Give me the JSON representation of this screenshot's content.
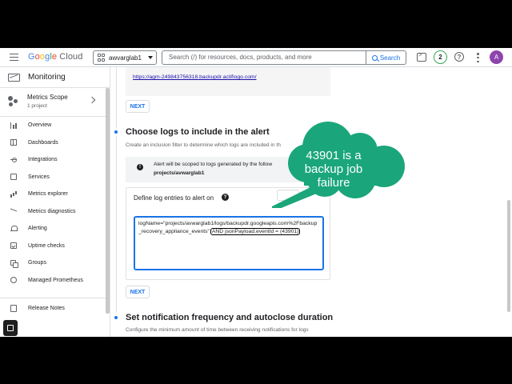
{
  "topbar": {
    "logo": {
      "g": "G",
      "o1": "o",
      "o2": "o",
      "g2": "g",
      "l": "l",
      "e": "e",
      "cloud": " Cloud"
    },
    "project": "awvarglab1",
    "search_placeholder": "Search (/) for resources, docs, products, and more",
    "search_button": "Search",
    "notifications_count": "2",
    "help": "?",
    "avatar_letter": "A"
  },
  "sidebar": {
    "title": "Monitoring",
    "metrics_scope": {
      "title": "Metrics Scope",
      "subtitle": "1 project"
    },
    "items": [
      {
        "label": "Overview",
        "icon": "overview-icon"
      },
      {
        "label": "Dashboards",
        "icon": "dashboards-icon"
      },
      {
        "label": "Integrations",
        "icon": "integrations-icon"
      },
      {
        "label": "Services",
        "icon": "services-icon"
      },
      {
        "label": "Metrics explorer",
        "icon": "metrics-explorer-icon"
      },
      {
        "label": "Metrics diagnostics",
        "icon": "metrics-diagnostics-icon"
      },
      {
        "label": "Alerting",
        "icon": "bell-icon"
      },
      {
        "label": "Uptime checks",
        "icon": "uptime-icon"
      },
      {
        "label": "Groups",
        "icon": "groups-icon"
      },
      {
        "label": "Managed Prometheus",
        "icon": "prometheus-icon"
      }
    ],
    "footer": "Release Notes"
  },
  "main": {
    "url_link": "https://agm-249843756318.backupdr.actifiogo.com/",
    "next_label": "NEXT",
    "logs_section": {
      "title": "Choose logs to include in the alert",
      "description": "Create an inclusion filter to determine which logs are included in th",
      "info_text": "Alert will be scoped to logs generated by the follow",
      "info_path": "projects/avwarglab1",
      "filter_label": "Define log entries to alert on",
      "query_main": "logName=\"projects/avwarglab1/logs/backupdr.googleapis.com%2Fbackup_recovery_appliance_events\" ",
      "query_highlight": "AND jsonPayload.eventId = (43901)"
    },
    "notification_section": {
      "title": "Set notification frequency and autoclose duration",
      "description": "Configure the minimum amount of time between receiving notifications for logs"
    }
  },
  "annotation": {
    "text": "43901 is a backup job failure",
    "color": "#1aa67a"
  }
}
